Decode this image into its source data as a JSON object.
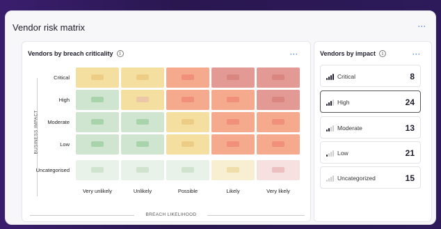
{
  "title": "Vendor risk matrix",
  "more_label": "···",
  "matrix": {
    "title": "Vendors by breach criticality",
    "info": "i",
    "y_axis_label": "BUSINESS IMPACT",
    "x_axis_label": "BREACH LIKELIHOOD",
    "rows": [
      "Critical",
      "High",
      "Moderate",
      "Low",
      "Uncategorised"
    ],
    "columns": [
      "Very unlikely",
      "Unlikely",
      "Possible",
      "Likely",
      "Very likely"
    ],
    "cells": [
      [
        {
          "bg": "#f4dfa0",
          "pill": "#edcd86"
        },
        {
          "bg": "#f4dfa0",
          "pill": "#edcd86"
        },
        {
          "bg": "#f5a98d",
          "pill": "#f0907a"
        },
        {
          "bg": "#e39a94",
          "pill": "#d98580"
        },
        {
          "bg": "#e39a94",
          "pill": "#d98580"
        }
      ],
      [
        {
          "bg": "#cfe5cf",
          "pill": "#a9d3ab"
        },
        {
          "bg": "#f4dfa0",
          "pill": "#edc8a8"
        },
        {
          "bg": "#f5a98d",
          "pill": "#f0907a"
        },
        {
          "bg": "#f5a98d",
          "pill": "#f0907a"
        },
        {
          "bg": "#e39a94",
          "pill": "#d98580"
        }
      ],
      [
        {
          "bg": "#cfe5cf",
          "pill": "#a9d3ab"
        },
        {
          "bg": "#cfe5cf",
          "pill": "#a9d3ab"
        },
        {
          "bg": "#f4dfa0",
          "pill": "#edcd86"
        },
        {
          "bg": "#f5a98d",
          "pill": "#f0907a"
        },
        {
          "bg": "#f5a98d",
          "pill": "#f0907a"
        }
      ],
      [
        {
          "bg": "#cfe5cf",
          "pill": "#a9d3ab"
        },
        {
          "bg": "#cfe5cf",
          "pill": "#a9d3ab"
        },
        {
          "bg": "#f4dfa0",
          "pill": "#edcd86"
        },
        {
          "bg": "#f5a98d",
          "pill": "#f0907a"
        },
        {
          "bg": "#f5a98d",
          "pill": "#f0907a"
        }
      ],
      [
        {
          "bg": "#e9f2e9",
          "pill": "#cfe3cf"
        },
        {
          "bg": "#e9f2e9",
          "pill": "#cfe3cf"
        },
        {
          "bg": "#e9f2e9",
          "pill": "#cfe3cf"
        },
        {
          "bg": "#f8efd2",
          "pill": "#f0deaa"
        },
        {
          "bg": "#f6e0e0",
          "pill": "#ecc0c0"
        }
      ]
    ]
  },
  "impact": {
    "title": "Vendors by impact",
    "info": "i",
    "items": [
      {
        "label": "Critical",
        "count": "8",
        "level": 4,
        "selected": false
      },
      {
        "label": "High",
        "count": "24",
        "level": 3,
        "selected": true
      },
      {
        "label": "Moderate",
        "count": "13",
        "level": 2,
        "selected": false
      },
      {
        "label": "Low",
        "count": "21",
        "level": 1,
        "selected": false
      },
      {
        "label": "Uncategorized",
        "count": "15",
        "level": 0,
        "selected": false
      }
    ]
  },
  "colors": {
    "accent": "#3b6fd8",
    "bar_active": "#1c1c2a",
    "bar_inactive": "#cccccc"
  }
}
